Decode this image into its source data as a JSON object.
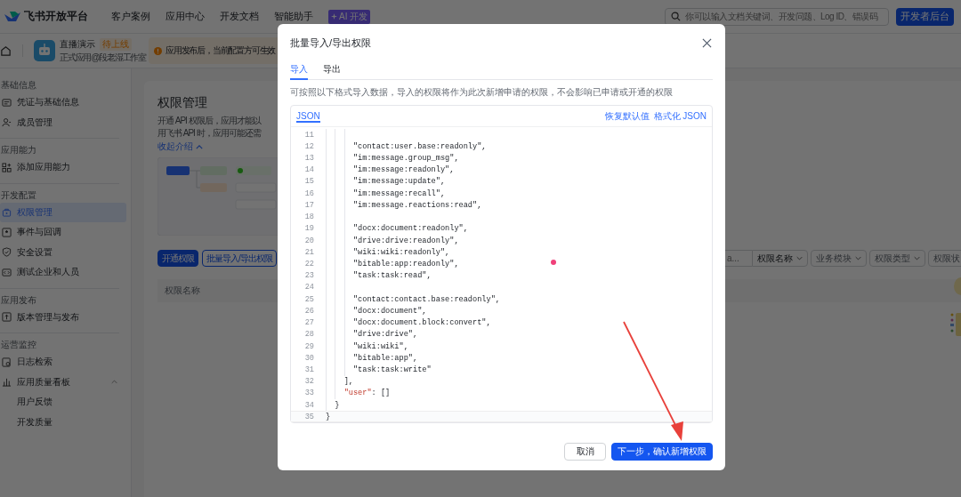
{
  "header": {
    "logo": "飞书开放平台",
    "nav": [
      {
        "label": "客户案例"
      },
      {
        "label": "应用中心"
      },
      {
        "label": "开发文档"
      },
      {
        "label": "智能助手",
        "badge": "AI 开发"
      }
    ],
    "search": {
      "placeholder": "你可以输入文档关键词、开发问题、Log ID、错误码"
    },
    "console_button": "开发者后台"
  },
  "app_bar": {
    "app_name": "直播演示",
    "status_tag": "待上线",
    "subtitle": "正式应用@段老湿工作室",
    "notice": "应用发布后，当前配置方可生效"
  },
  "sidebar": {
    "sections": [
      {
        "title": "基础信息",
        "items": [
          {
            "label": "凭证与基础信息",
            "selected": false
          },
          {
            "label": "成员管理",
            "selected": false
          }
        ]
      },
      {
        "title": "应用能力",
        "items": [
          {
            "label": "添加应用能力",
            "selected": false
          }
        ]
      },
      {
        "title": "开发配置",
        "items": [
          {
            "label": "权限管理",
            "selected": true
          },
          {
            "label": "事件与回调",
            "selected": false
          },
          {
            "label": "安全设置",
            "selected": false
          },
          {
            "label": "测试企业和人员",
            "selected": false
          }
        ]
      },
      {
        "title": "应用发布",
        "items": [
          {
            "label": "版本管理与发布",
            "selected": false
          }
        ]
      },
      {
        "title": "运营监控",
        "items": [
          {
            "label": "日志检索",
            "selected": false
          },
          {
            "label": "应用质量看板",
            "selected": false,
            "expanded": true,
            "children": [
              {
                "label": "用户反馈",
                "selected": false
              },
              {
                "label": "开发质量",
                "selected": false
              }
            ]
          }
        ]
      }
    ]
  },
  "main": {
    "title": "权限管理",
    "description": [
      "开通 API 权限后，应用才能以",
      "用飞书 API 时，应用可能还需"
    ],
    "collapse_link": "收起介绍",
    "buttons": [
      {
        "label": "开通权限",
        "kind": "primary"
      },
      {
        "label": "批量导入/导出权限",
        "kind": "outline"
      }
    ],
    "filter_search": {
      "placeholder": "a..."
    },
    "filters": [
      {
        "label": "权限名称"
      },
      {
        "label": "业务模块"
      },
      {
        "label": "权限类型"
      },
      {
        "label": "权限状"
      }
    ],
    "table": {
      "columns": [
        "权限名称"
      ]
    }
  },
  "modal": {
    "title": "批量导入/导出权限",
    "tabs": [
      {
        "label": "导入",
        "selected": true
      },
      {
        "label": "导出",
        "selected": false
      }
    ],
    "hint": "可按照以下格式导入数据，导入的权限将作为此次新增申请的权限，不会影响已申请或开通的权限",
    "editor": {
      "tabs": [
        {
          "label": "JSON",
          "selected": true
        }
      ],
      "actions": [
        "恢复默认值",
        "格式化 JSON"
      ],
      "lines": [
        {
          "number": "11",
          "active": false
        },
        {
          "number": "12",
          "active": false,
          "parts": [
            {
              "kind": "string",
              "text": "      \"contact:user.base:readonly\","
            }
          ]
        },
        {
          "number": "13",
          "active": false,
          "parts": [
            {
              "kind": "string",
              "text": "      \"im:message.group_msg\","
            }
          ]
        },
        {
          "number": "14",
          "active": false,
          "parts": [
            {
              "kind": "string",
              "text": "      \"im:message:readonly\","
            }
          ]
        },
        {
          "number": "15",
          "active": false,
          "parts": [
            {
              "kind": "string",
              "text": "      \"im:message:update\","
            }
          ]
        },
        {
          "number": "16",
          "active": false,
          "parts": [
            {
              "kind": "string",
              "text": "      \"im:message:recall\","
            }
          ]
        },
        {
          "number": "17",
          "active": false,
          "parts": [
            {
              "kind": "string",
              "text": "      \"im:message.reactions:read\","
            }
          ]
        },
        {
          "number": "18",
          "active": false
        },
        {
          "number": "19",
          "active": false,
          "parts": [
            {
              "kind": "string",
              "text": "      \"docx:document:readonly\","
            }
          ]
        },
        {
          "number": "20",
          "active": false,
          "parts": [
            {
              "kind": "string",
              "text": "      \"drive:drive:readonly\","
            }
          ]
        },
        {
          "number": "21",
          "active": false,
          "parts": [
            {
              "kind": "string",
              "text": "      \"wiki:wiki:readonly\","
            }
          ]
        },
        {
          "number": "22",
          "active": false,
          "parts": [
            {
              "kind": "string",
              "text": "      \"bitable:app:readonly\","
            }
          ]
        },
        {
          "number": "23",
          "active": false,
          "parts": [
            {
              "kind": "string",
              "text": "      \"task:task:read\","
            }
          ]
        },
        {
          "number": "24",
          "active": false
        },
        {
          "number": "25",
          "active": false,
          "parts": [
            {
              "kind": "string",
              "text": "      \"contact:contact.base:readonly\","
            }
          ]
        },
        {
          "number": "26",
          "active": false,
          "parts": [
            {
              "kind": "string",
              "text": "      \"docx:document\","
            }
          ]
        },
        {
          "number": "27",
          "active": false,
          "parts": [
            {
              "kind": "string",
              "text": "      \"docx:document.block:convert\","
            }
          ]
        },
        {
          "number": "28",
          "active": false,
          "parts": [
            {
              "kind": "string",
              "text": "      \"drive:drive\","
            }
          ]
        },
        {
          "number": "29",
          "active": false,
          "parts": [
            {
              "kind": "string",
              "text": "      \"wiki:wiki\","
            }
          ]
        },
        {
          "number": "30",
          "active": false,
          "parts": [
            {
              "kind": "string",
              "text": "      \"bitable:app\","
            }
          ]
        },
        {
          "number": "31",
          "active": false,
          "parts": [
            {
              "kind": "string",
              "text": "      \"task:task:write\""
            }
          ]
        },
        {
          "number": "32",
          "active": false,
          "parts": [
            {
              "kind": "plain",
              "text": "    ],"
            }
          ]
        },
        {
          "number": "33",
          "active": false,
          "parts": [
            {
              "kind": "key",
              "text": "    \"user\""
            },
            {
              "kind": "plain",
              "text": ": []"
            }
          ]
        },
        {
          "number": "34",
          "active": false,
          "parts": [
            {
              "kind": "plain",
              "text": "  }"
            }
          ]
        },
        {
          "number": "35",
          "active": true,
          "parts": [
            {
              "kind": "plain",
              "text": "}"
            }
          ]
        }
      ]
    },
    "buttons": [
      {
        "label": "取消",
        "kind": "secondary"
      },
      {
        "label": "下一步，确认新增权限",
        "kind": "primary"
      }
    ]
  }
}
